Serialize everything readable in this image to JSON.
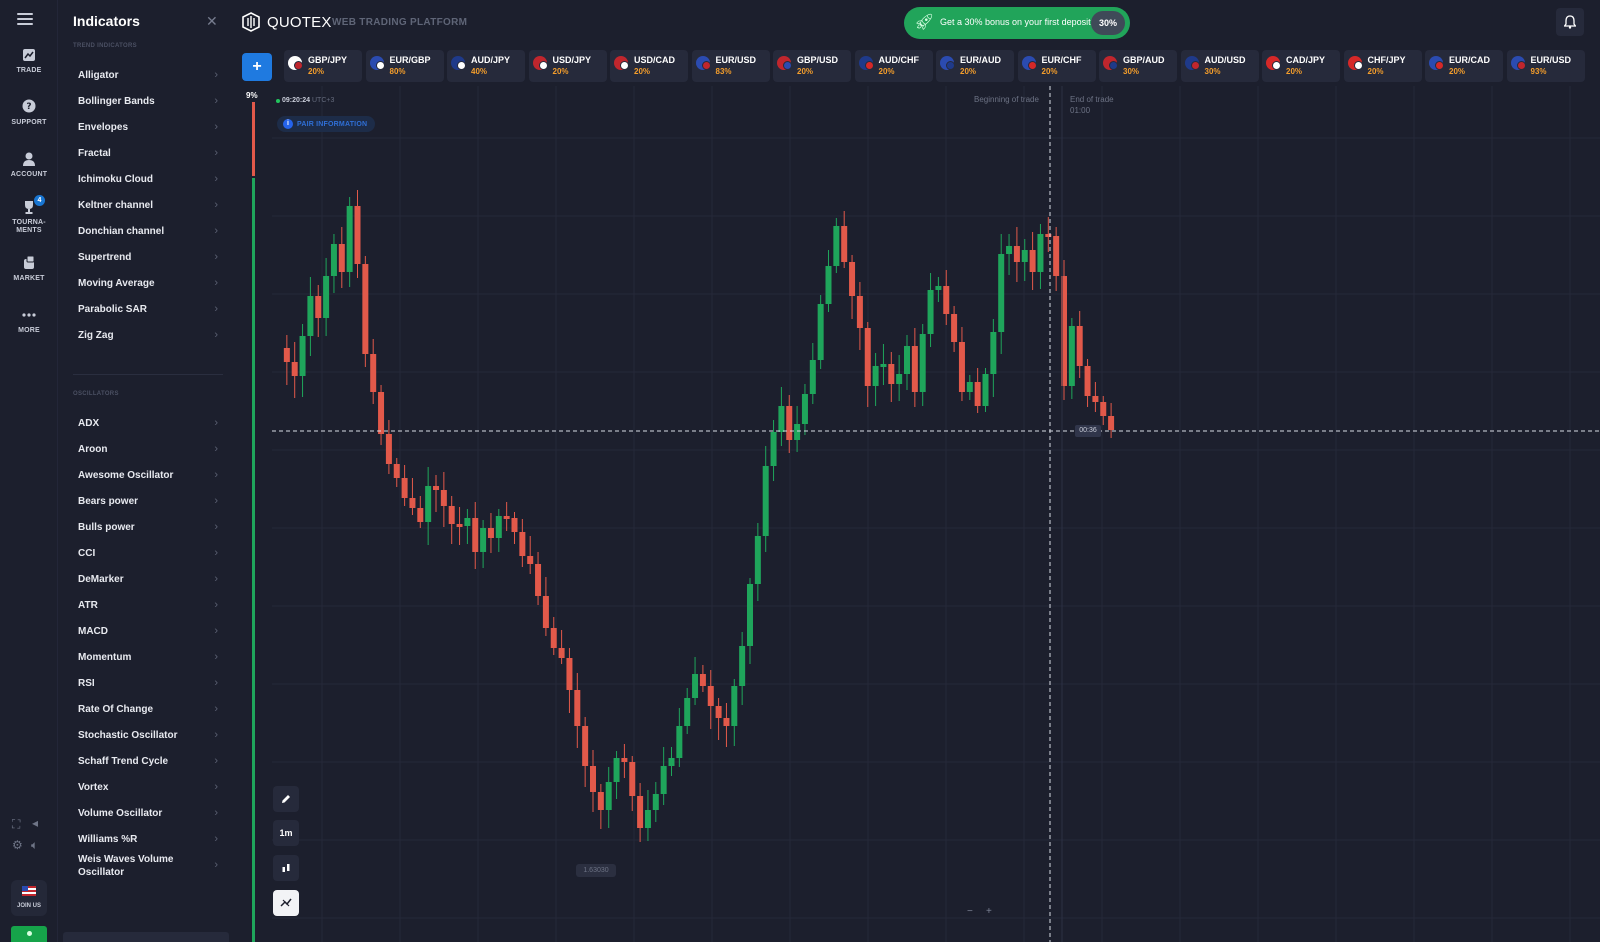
{
  "rail": {
    "items": [
      {
        "label": "TRADE"
      },
      {
        "label": "SUPPORT"
      },
      {
        "label": "ACCOUNT"
      },
      {
        "label": "TOURNA-MENTS",
        "badge": "4"
      },
      {
        "label": "MARKET"
      },
      {
        "label": "MORE"
      }
    ],
    "join_label": "JOIN US"
  },
  "panel": {
    "title": "Indicators",
    "trend_section": "TREND INDICATORS",
    "oscillators_section": "OSCILLATORS",
    "trend": [
      "Alligator",
      "Bollinger Bands",
      "Envelopes",
      "Fractal",
      "Ichimoku Cloud",
      "Keltner channel",
      "Donchian channel",
      "Supertrend",
      "Moving Average",
      "Parabolic SAR",
      "Zig Zag"
    ],
    "oscillators": [
      "ADX",
      "Aroon",
      "Awesome Oscillator",
      "Bears power",
      "Bulls power",
      "CCI",
      "DeMarker",
      "ATR",
      "MACD",
      "Momentum",
      "RSI",
      "Rate Of Change",
      "Stochastic Oscillator",
      "Schaff Trend Cycle",
      "Vortex",
      "Volume Oscillator",
      "Williams %R",
      "Weis Waves Volume Oscillator"
    ]
  },
  "header": {
    "brand": "QUOTEX",
    "platform": "WEB TRADING PLATFORM",
    "promo_text": "Get a 30% bonus on your first deposit",
    "promo_pct": "30%"
  },
  "assets": [
    {
      "pair": "GBP/JPY",
      "payout": "20%",
      "c1": "#ffffff",
      "c2": "#c0262d"
    },
    {
      "pair": "EUR/GBP",
      "payout": "80%",
      "c1": "#2b4bb0",
      "c2": "#ffffff"
    },
    {
      "pair": "AUD/JPY",
      "payout": "40%",
      "c1": "#1f3a8a",
      "c2": "#ffffff"
    },
    {
      "pair": "USD/JPY",
      "payout": "20%",
      "c1": "#c0262d",
      "c2": "#ffffff"
    },
    {
      "pair": "USD/CAD",
      "payout": "20%",
      "c1": "#c0262d",
      "c2": "#ffffff"
    },
    {
      "pair": "EUR/USD",
      "payout": "83%",
      "c1": "#2b4bb0",
      "c2": "#c0262d"
    },
    {
      "pair": "GBP/USD",
      "payout": "20%",
      "c1": "#c0262d",
      "c2": "#2b4bb0"
    },
    {
      "pair": "AUD/CHF",
      "payout": "20%",
      "c1": "#1f3a8a",
      "c2": "#d62828"
    },
    {
      "pair": "EUR/AUD",
      "payout": "20%",
      "c1": "#2b4bb0",
      "c2": "#1f3a8a"
    },
    {
      "pair": "EUR/CHF",
      "payout": "20%",
      "c1": "#2b4bb0",
      "c2": "#d62828"
    },
    {
      "pair": "GBP/AUD",
      "payout": "30%",
      "c1": "#c0262d",
      "c2": "#1f3a8a"
    },
    {
      "pair": "AUD/USD",
      "payout": "30%",
      "c1": "#1f3a8a",
      "c2": "#c0262d"
    },
    {
      "pair": "CAD/JPY",
      "payout": "20%",
      "c1": "#d62828",
      "c2": "#ffffff"
    },
    {
      "pair": "CHF/JPY",
      "payout": "20%",
      "c1": "#d62828",
      "c2": "#ffffff"
    },
    {
      "pair": "EUR/CAD",
      "payout": "20%",
      "c1": "#2b4bb0",
      "c2": "#d62828"
    },
    {
      "pair": "EUR/USD",
      "payout": "93%",
      "c1": "#2b4bb0",
      "c2": "#c0262d"
    }
  ],
  "chart": {
    "sentiment_pct": "9%",
    "time": "09:20:24",
    "tz": "UTC+3",
    "pair_info": "PAIR INFORMATION",
    "begin_label": "Beginning of trade",
    "end_label": "End of trade",
    "end_time": "01:00",
    "countdown": "00:36",
    "low_price": "1.63030",
    "timeframe": "1m",
    "zoom_out": "−",
    "zoom_in": "+",
    "up_color": "#1fa55b",
    "down_color": "#e2594a"
  }
}
